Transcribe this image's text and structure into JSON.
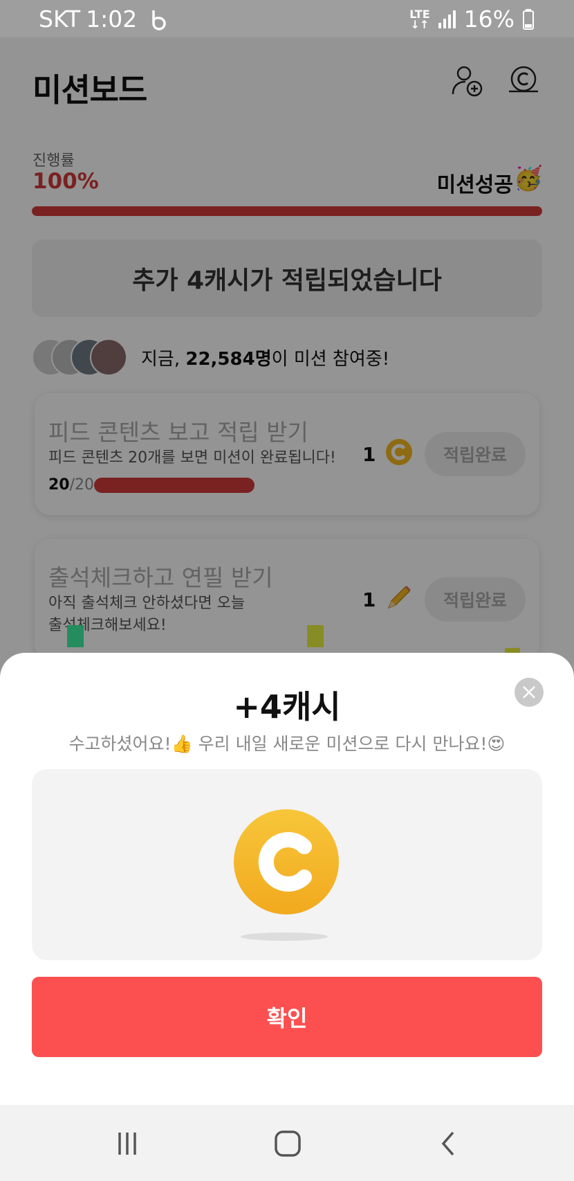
{
  "status_bar": {
    "carrier": "SKT",
    "time": "1:02",
    "network": "LTE",
    "battery": "16%"
  },
  "header": {
    "title": "미션보드",
    "icons": [
      "add-friend-icon",
      "cash-icon"
    ]
  },
  "progress": {
    "label": "진행률",
    "value": "100%",
    "fill": 1.0,
    "status_text": "미션성공",
    "status_emoji": "🥳"
  },
  "notice": {
    "text": "추가 4캐시가 적립되었습니다"
  },
  "participants": {
    "prefix": "지금, ",
    "count": "22,584명",
    "suffix": "이 미션 참여중!"
  },
  "missions": [
    {
      "title": "피드 콘텐츠 보고 적립 받기",
      "description": "피드 콘텐츠 20개를 보면 미션이 완료됩니다!",
      "progress_done": "20",
      "progress_total": "/20",
      "progress_fill": 1.0,
      "reward_count": "1",
      "reward_icon": "coin-icon",
      "button": "적립완료"
    },
    {
      "title": "출석체크하고 연필 받기",
      "description": "아직 출석체크 안하셨다면 오늘 출석체크해보세요!",
      "reward_count": "1",
      "reward_icon": "pencil-icon",
      "button": "적립완료"
    }
  ],
  "modal": {
    "title": "+4캐시",
    "subtitle": "수고하셨어요!👍 우리 내일 새로운 미션으로 다시 만나요!😍",
    "confirm_label": "확인"
  },
  "nav": {
    "buttons": [
      "recent-apps-icon",
      "home-icon",
      "back-icon"
    ]
  },
  "colors": {
    "accent": "#d23a3a",
    "confirm": "#fc5050",
    "coin": "#f5b820"
  }
}
